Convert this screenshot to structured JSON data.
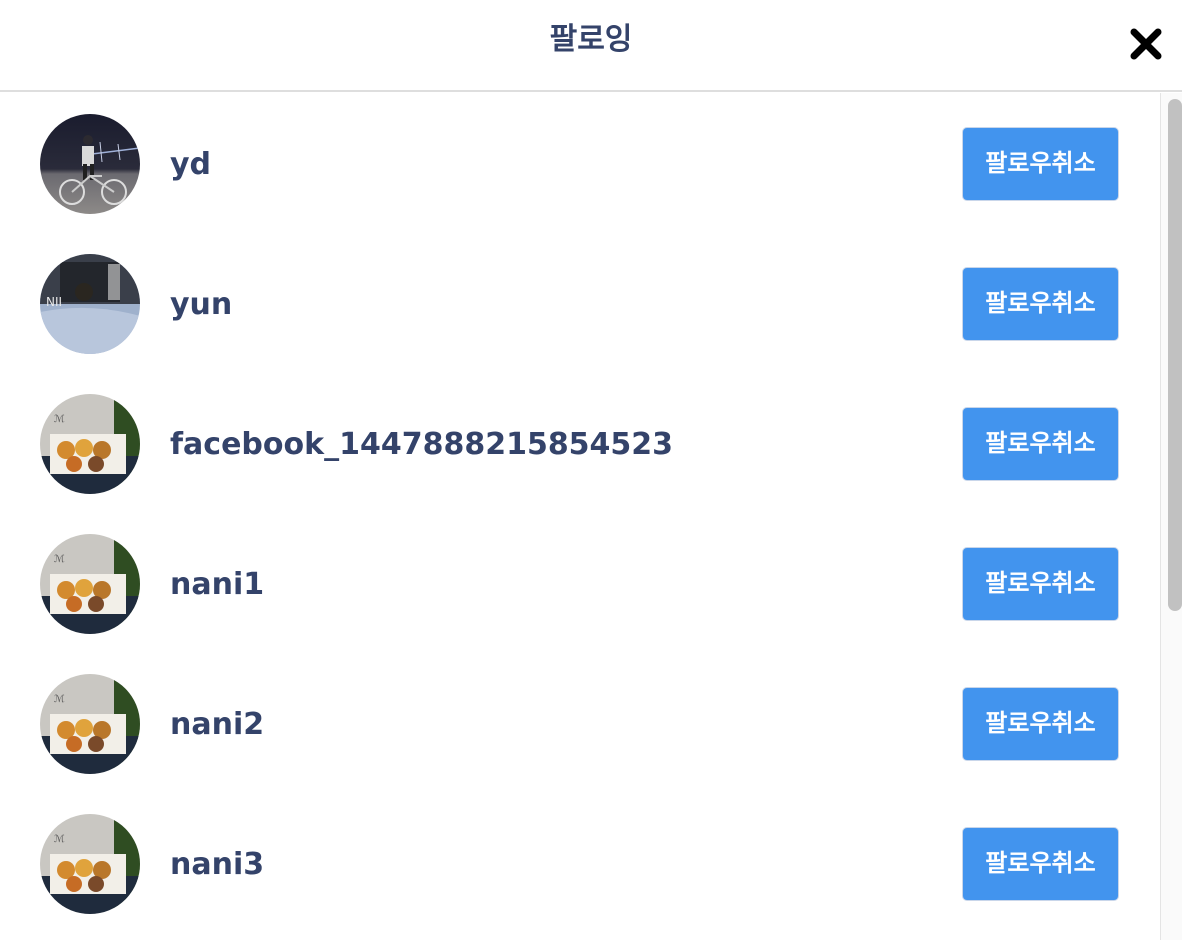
{
  "modal": {
    "title": "팔로잉",
    "close_icon": "close-icon"
  },
  "users": [
    {
      "username": "yd",
      "button_label": "팔로우취소",
      "avatar": "avatar-night-bicycle"
    },
    {
      "username": "yun",
      "button_label": "팔로우취소",
      "avatar": "avatar-dark-photo"
    },
    {
      "username": "facebook_1447888215854523",
      "button_label": "팔로우취소",
      "avatar": "avatar-food-box"
    },
    {
      "username": "nani1",
      "button_label": "팔로우취소",
      "avatar": "avatar-food-box"
    },
    {
      "username": "nani2",
      "button_label": "팔로우취소",
      "avatar": "avatar-food-box"
    },
    {
      "username": "nani3",
      "button_label": "팔로우취소",
      "avatar": "avatar-food-box"
    }
  ],
  "colors": {
    "accent": "#4294ee",
    "text": "#34436a",
    "divider": "#dedede"
  }
}
